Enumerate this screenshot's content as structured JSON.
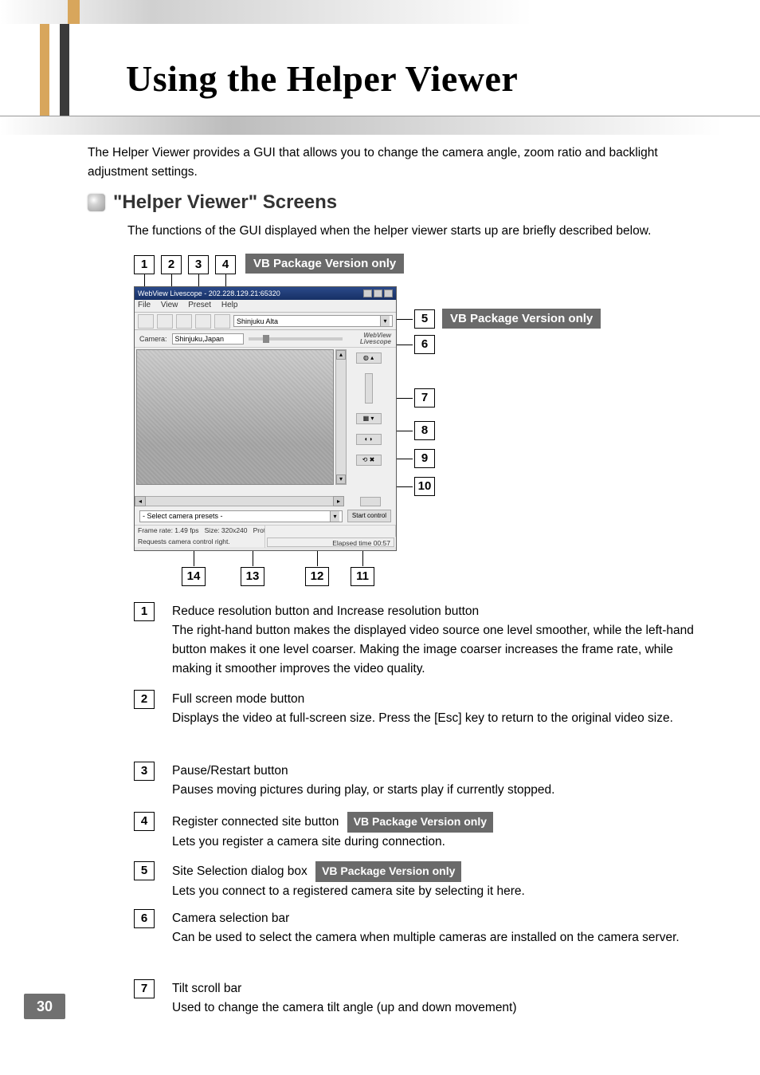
{
  "page_number": "30",
  "page_title": "Using the Helper Viewer",
  "intro": "The Helper Viewer provides a GUI that allows you to change the camera angle, zoom ratio and backlight adjustment settings.",
  "section": {
    "title": "\"Helper Viewer\" Screens",
    "subtitle": "The functions of the GUI displayed when the helper viewer starts up are briefly described below."
  },
  "badges": {
    "vb_only": "VB Package Version only"
  },
  "callouts_top": [
    "1",
    "2",
    "3",
    "4"
  ],
  "callouts_right": [
    "5",
    "6",
    "7",
    "8",
    "9",
    "10"
  ],
  "callouts_bottom": [
    "14",
    "13",
    "12",
    "11"
  ],
  "appwin": {
    "title": "WebView Livescope - 202.228.129.21:65320",
    "menus": [
      "File",
      "View",
      "Preset",
      "Help"
    ],
    "site_selection_value": "Shinjuku Alta",
    "camera_label": "Camera:",
    "camera_value": "Shinjuku,Japan",
    "logo_line1": "WebView",
    "logo_line2": "Livescope",
    "preset_value": "- Select camera presets -",
    "start_control_label": "Start control",
    "status_frame": "Frame rate:  1.49 fps",
    "status_size": "Size: 320x240",
    "status_protocol": "Protocol: WV-TCP",
    "status_request": "Requests camera control right.",
    "status_elapsed": "Elapsed time 00:57"
  },
  "items": [
    {
      "n": "1",
      "head": "Reduce resolution button and Increase resolution button",
      "text": "The right-hand button makes the displayed video source one level smoother, while the left-hand button makes it one level coarser. Making the image coarser increases the frame rate, while making it smoother improves the video quality."
    },
    {
      "n": "2",
      "head": "Full screen mode button",
      "text": "Displays the video at full-screen size. Press the [Esc] key to return to the original video size."
    },
    {
      "n": "3",
      "head": "Pause/Restart button",
      "text": "Pauses moving pictures during play, or starts play if currently stopped."
    },
    {
      "n": "4",
      "head": "Register connected site button",
      "badge": true,
      "text": "Lets you register a camera site during connection."
    },
    {
      "n": "5",
      "head": "Site Selection dialog box",
      "badge": true,
      "text": "Lets you connect to a registered camera site by selecting it here."
    },
    {
      "n": "6",
      "head": "Camera selection bar",
      "text": "Can be used to select the camera when multiple cameras are installed on the camera server."
    },
    {
      "n": "7",
      "head": "Tilt scroll bar",
      "text": "Used to change the camera tilt angle (up and down movement)"
    }
  ]
}
